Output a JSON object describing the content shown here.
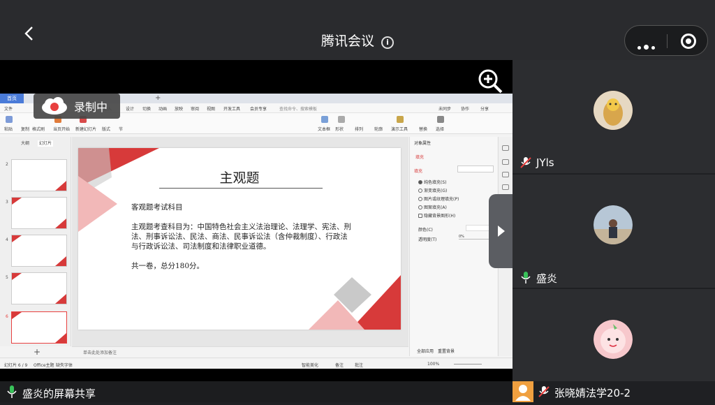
{
  "header": {
    "title": "腾讯会议"
  },
  "recording": {
    "label": "录制中"
  },
  "share": {
    "label": "盛炎的屏幕共享"
  },
  "wps": {
    "home_tab": "首页",
    "menu": [
      "文件",
      "开始",
      "插入",
      "设计",
      "切换",
      "动画",
      "放映",
      "审阅",
      "视图",
      "开发工具",
      "会员专享",
      "查找命令、搜索模板",
      "未同步",
      "协作",
      "分享"
    ],
    "ribbon": [
      "粘贴",
      "复制",
      "格式刷",
      "当页开始",
      "新建幻灯片",
      "版式",
      "节",
      "重置",
      "文本框",
      "形状",
      "排列",
      "轮廓",
      "演示工具",
      "替换",
      "选择"
    ],
    "thumb_tabs": [
      "大纲",
      "幻灯片"
    ],
    "thumb_numbers": [
      "2",
      "3",
      "4",
      "5",
      "6"
    ],
    "slide": {
      "title": "主观题",
      "line1": "客观题考试科目",
      "line2a": "主观题考查科目为：中国特色社会主义法治理论、法理学、宪法、刑",
      "line2b": "法、刑事诉讼法、民法、商法、民事诉讼法（含仲裁制度）、行政法",
      "line2c": "与行政诉讼法、司法制度和法律职业道德。",
      "line3": "共一卷，总分180分。"
    },
    "notes_placeholder": "单击此处添加备注",
    "props": {
      "header": "对象属性",
      "tab": "填充",
      "section": "填充",
      "options": [
        "纯色填充(S)",
        "渐变填充(G)",
        "图片或纹理填充(P)",
        "图案填充(A)",
        "隐藏背景图形(H)"
      ],
      "color_label": "颜色(C)",
      "transparency_label": "透明度(T)",
      "transparency_value": "0%",
      "apply_all": "全部应用",
      "reset_bg": "重置背景"
    },
    "status": {
      "slide_pos": "幻灯片 6 / 9",
      "theme": "Office主题",
      "font_missing": "缺失字体",
      "smart_beautify": "智能美化",
      "notes": "备注",
      "comments": "批注",
      "zoom": "100%"
    }
  },
  "participants": [
    {
      "name": "JYls",
      "mic": "muted"
    },
    {
      "name": "盛炎",
      "mic": "active"
    },
    {
      "name": "张晓婧法学20-2",
      "mic": "muted"
    }
  ],
  "colors": {
    "accent_red": "#d73a3a",
    "pink": "#f2b8b8",
    "gray": "#c9c9c9",
    "mic_green": "#39c25a"
  }
}
